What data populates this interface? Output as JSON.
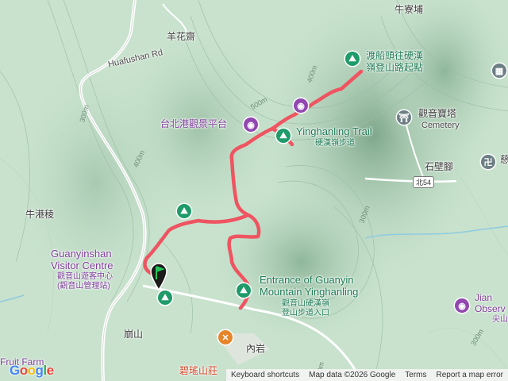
{
  "map": {
    "places": {
      "niuliaopu": "牛寮埔",
      "yanghuazhai": "羊花齋",
      "niugangling": "牛港稜",
      "shishan": "崩山",
      "neiyan": "內岩",
      "shibijiao": "石壁腳",
      "guanyinbaota": "觀音寶塔",
      "cemetery": "Cemetery",
      "jian_partial": "Jian",
      "observ_partial": "Observ",
      "jianshan_partial": "尖山",
      "bilao": "碧瑤山莊",
      "fruit_farm": "Fruit Farm",
      "ci_partial": "慈"
    },
    "pois": {
      "ferry_trailhead_line1": "渡船頭往硬漢",
      "ferry_trailhead_line2": "嶺登山路起點",
      "taipei_port_viewing": "台北港觀景平台",
      "yinghanling_trail": "Yinghanling Trail",
      "yinghanling_trail_zh": "硬漢嶺步道",
      "visitor_centre_line1": "Guanyinshan",
      "visitor_centre_line2": "Visitor Centre",
      "visitor_centre_zh1": "觀音山遊客中心",
      "visitor_centre_zh2": "(觀音山管理站)",
      "entrance_line1": "Entrance of Guanyin",
      "entrance_line2": "Mountain Yinghanling",
      "entrance_zh1": "觀音山硬漢嶺",
      "entrance_zh2": "登山步道入口"
    },
    "roads": {
      "huafushan": "Huafushan Rd",
      "route_shield": "北54"
    },
    "contours": [
      "400m",
      "500m",
      "300m",
      "400m",
      "300m",
      "300m",
      "400m"
    ],
    "track_color": "#ef5461",
    "accent_green": "#1e9b69",
    "accent_purple": "#9146b0"
  },
  "attribution": {
    "shortcuts": "Keyboard shortcuts",
    "mapdata": "Map data ©2026 Google",
    "terms": "Terms",
    "report": "Report a map error"
  },
  "google_logo": [
    "G",
    "o",
    "o",
    "g",
    "l",
    "e"
  ]
}
